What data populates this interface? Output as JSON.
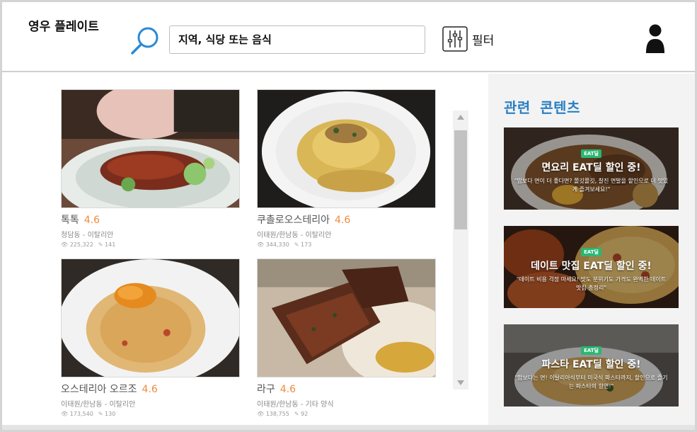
{
  "header": {
    "app_title": "영우 플레이트",
    "search_placeholder": "지역, 식당 또는 음식",
    "filter_label": "필터"
  },
  "restaurants": [
    {
      "name": "톡톡",
      "rating": "4.6",
      "location": "청담동 - 이탈리안",
      "views": "225,322",
      "reviews": "141"
    },
    {
      "name": "쿠촐로오스테리아",
      "rating": "4.6",
      "location": "이태원/한남동 - 이탈리안",
      "views": "344,330",
      "reviews": "173"
    },
    {
      "name": "오스테리아 오르조",
      "rating": "4.6",
      "location": "이태원/한남동 - 이탈리안",
      "views": "173,540",
      "reviews": "130"
    },
    {
      "name": "라구",
      "rating": "4.6",
      "location": "이태원/한남동 - 기타 양식",
      "views": "138,755",
      "reviews": "92"
    }
  ],
  "sidebar": {
    "title": "관련 콘텐츠",
    "promos": [
      {
        "badge": "EAT딜",
        "title": "면요리 EAT딜 할인 중!",
        "desc": "\"밥보다 면이 더 좋다면? 쫄깃쫄깃, 찰진 면발을 할인으로 더 맛있게 즐겨보세요!\""
      },
      {
        "badge": "EAT딜",
        "title": "데이트 맛집 EAT딜 할인 중!",
        "desc": "\"데이트 비용 걱정 마세요! 맛도 분위기도 가격도 완벽한 데이트 맛집 총정리\""
      },
      {
        "badge": "EAT딜",
        "title": "파스타 EAT딜 할인 중!",
        "desc": "\"밥보다는 면! 이탈리아식부터 미국식 파스타까지, 할인으로 즐기는 파스타의 향연!\""
      }
    ]
  },
  "icons": {
    "search": "search-icon",
    "filter": "sliders-icon",
    "user": "user-icon",
    "eye": "eye-icon",
    "pencil": "pencil-icon"
  },
  "colors": {
    "accent_blue": "#2a7fc3",
    "rating_orange": "#f08a3b",
    "badge_green": "#2bb673"
  }
}
